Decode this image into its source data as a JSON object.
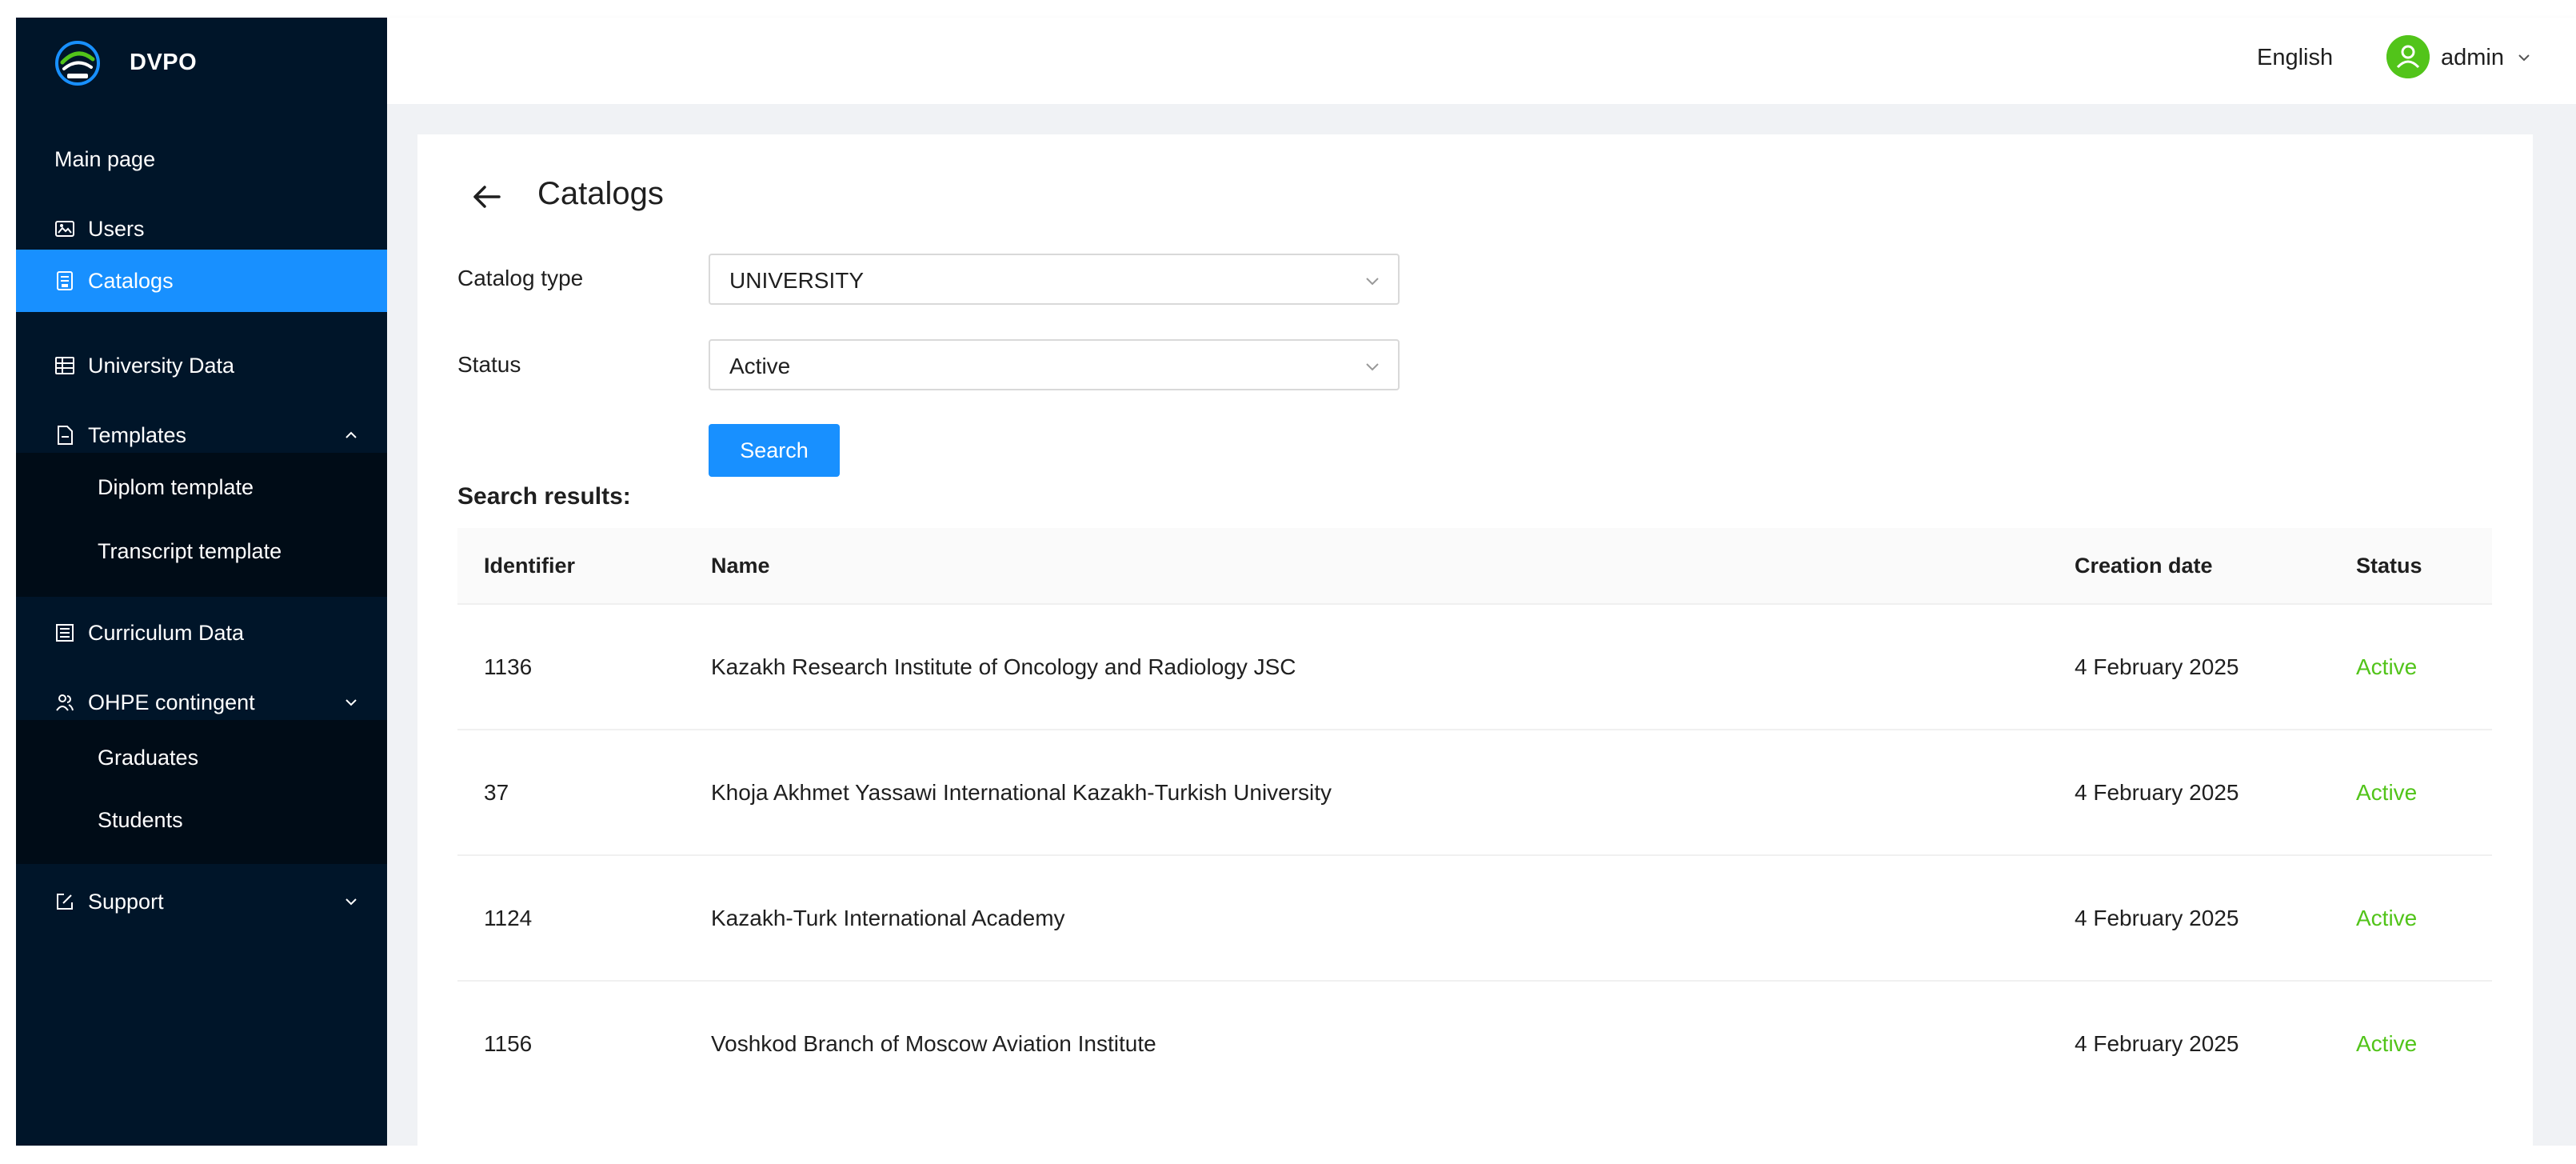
{
  "colors": {
    "sidebar_bg": "#001529",
    "submenu_bg": "#000c17",
    "accent": "#1890ff",
    "status_active": "#52c41a",
    "avatar_bg": "#52c41a"
  },
  "brand": {
    "name": "DVPO",
    "logo_icon": "dvpo-logo"
  },
  "sidebar": {
    "items": [
      {
        "label": "Main page",
        "icon": ""
      },
      {
        "label": "Users",
        "icon": "picture-icon"
      },
      {
        "label": "Catalogs",
        "icon": "book-icon",
        "active": true
      },
      {
        "label": "University Data",
        "icon": "table-icon"
      },
      {
        "label": "Templates",
        "icon": "file-icon",
        "expanded": true,
        "children": [
          "Diplom template",
          "Transcript template"
        ]
      },
      {
        "label": "Curriculum Data",
        "icon": "building-icon"
      },
      {
        "label": "OHPE contingent",
        "icon": "team-icon",
        "expanded": true,
        "children": [
          "Graduates",
          "Students"
        ]
      },
      {
        "label": "Support",
        "icon": "edit-icon",
        "expanded": false
      }
    ]
  },
  "header": {
    "language": "English",
    "user": "admin"
  },
  "page": {
    "title": "Catalogs"
  },
  "filters": {
    "catalog_type_label": "Catalog type",
    "catalog_type_value": "UNIVERSITY",
    "status_label": "Status",
    "status_value": "Active",
    "search_button": "Search"
  },
  "results": {
    "label": "Search results:",
    "columns": [
      "Identifier",
      "Name",
      "Creation date",
      "Status"
    ],
    "rows": [
      {
        "id": "1136",
        "name": "Kazakh Research Institute of Oncology and Radiology JSC",
        "date": "4 February 2025",
        "status": "Active"
      },
      {
        "id": "37",
        "name": "Khoja Akhmet Yassawi International Kazakh-Turkish University",
        "date": "4 February 2025",
        "status": "Active"
      },
      {
        "id": "1124",
        "name": "Kazakh-Turk International Academy",
        "date": "4 February 2025",
        "status": "Active"
      },
      {
        "id": "1156",
        "name": "Voshkod Branch of Moscow Aviation Institute",
        "date": "4 February 2025",
        "status": "Active"
      }
    ]
  }
}
